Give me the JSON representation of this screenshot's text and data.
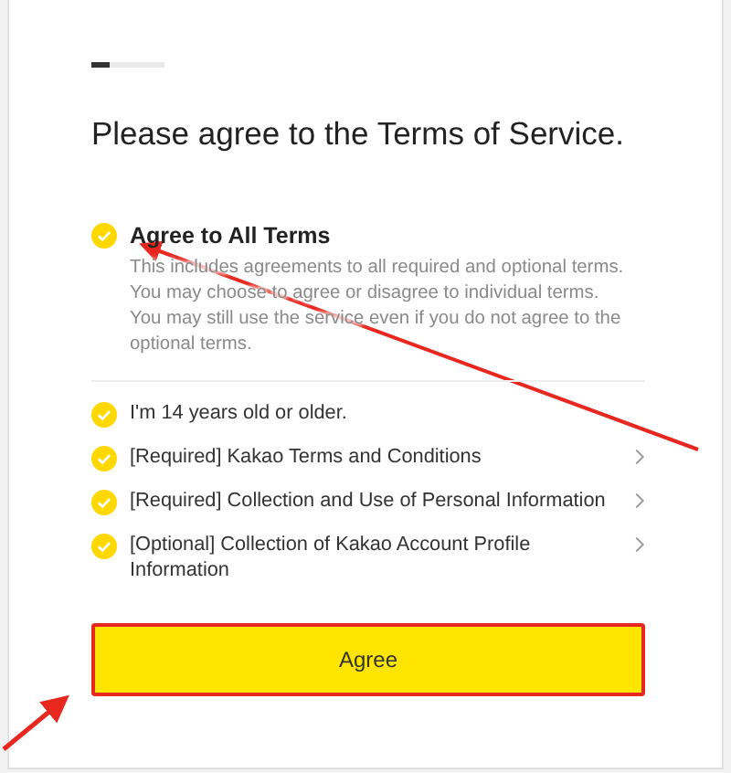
{
  "progress": {
    "level": 0.25
  },
  "title": "Please agree to the Terms of Service.",
  "agree_all": {
    "label": "Agree to All Terms",
    "checked": true,
    "description": "This includes agreements to all required and optional terms. You may choose to agree or disagree to individual terms.\nYou may still use the service even if you do not agree to the optional terms."
  },
  "terms": [
    {
      "label": "I'm 14 years old or older.",
      "checked": true,
      "kind": "plain"
    },
    {
      "label": "[Required] Kakao Terms and Conditions",
      "checked": true,
      "kind": "link"
    },
    {
      "label": "[Required] Collection and Use of Personal Information",
      "checked": true,
      "kind": "link"
    },
    {
      "label": "[Optional] Collection of Kakao Account Profile Information",
      "checked": true,
      "kind": "link"
    }
  ],
  "button": {
    "label": "Agree"
  }
}
